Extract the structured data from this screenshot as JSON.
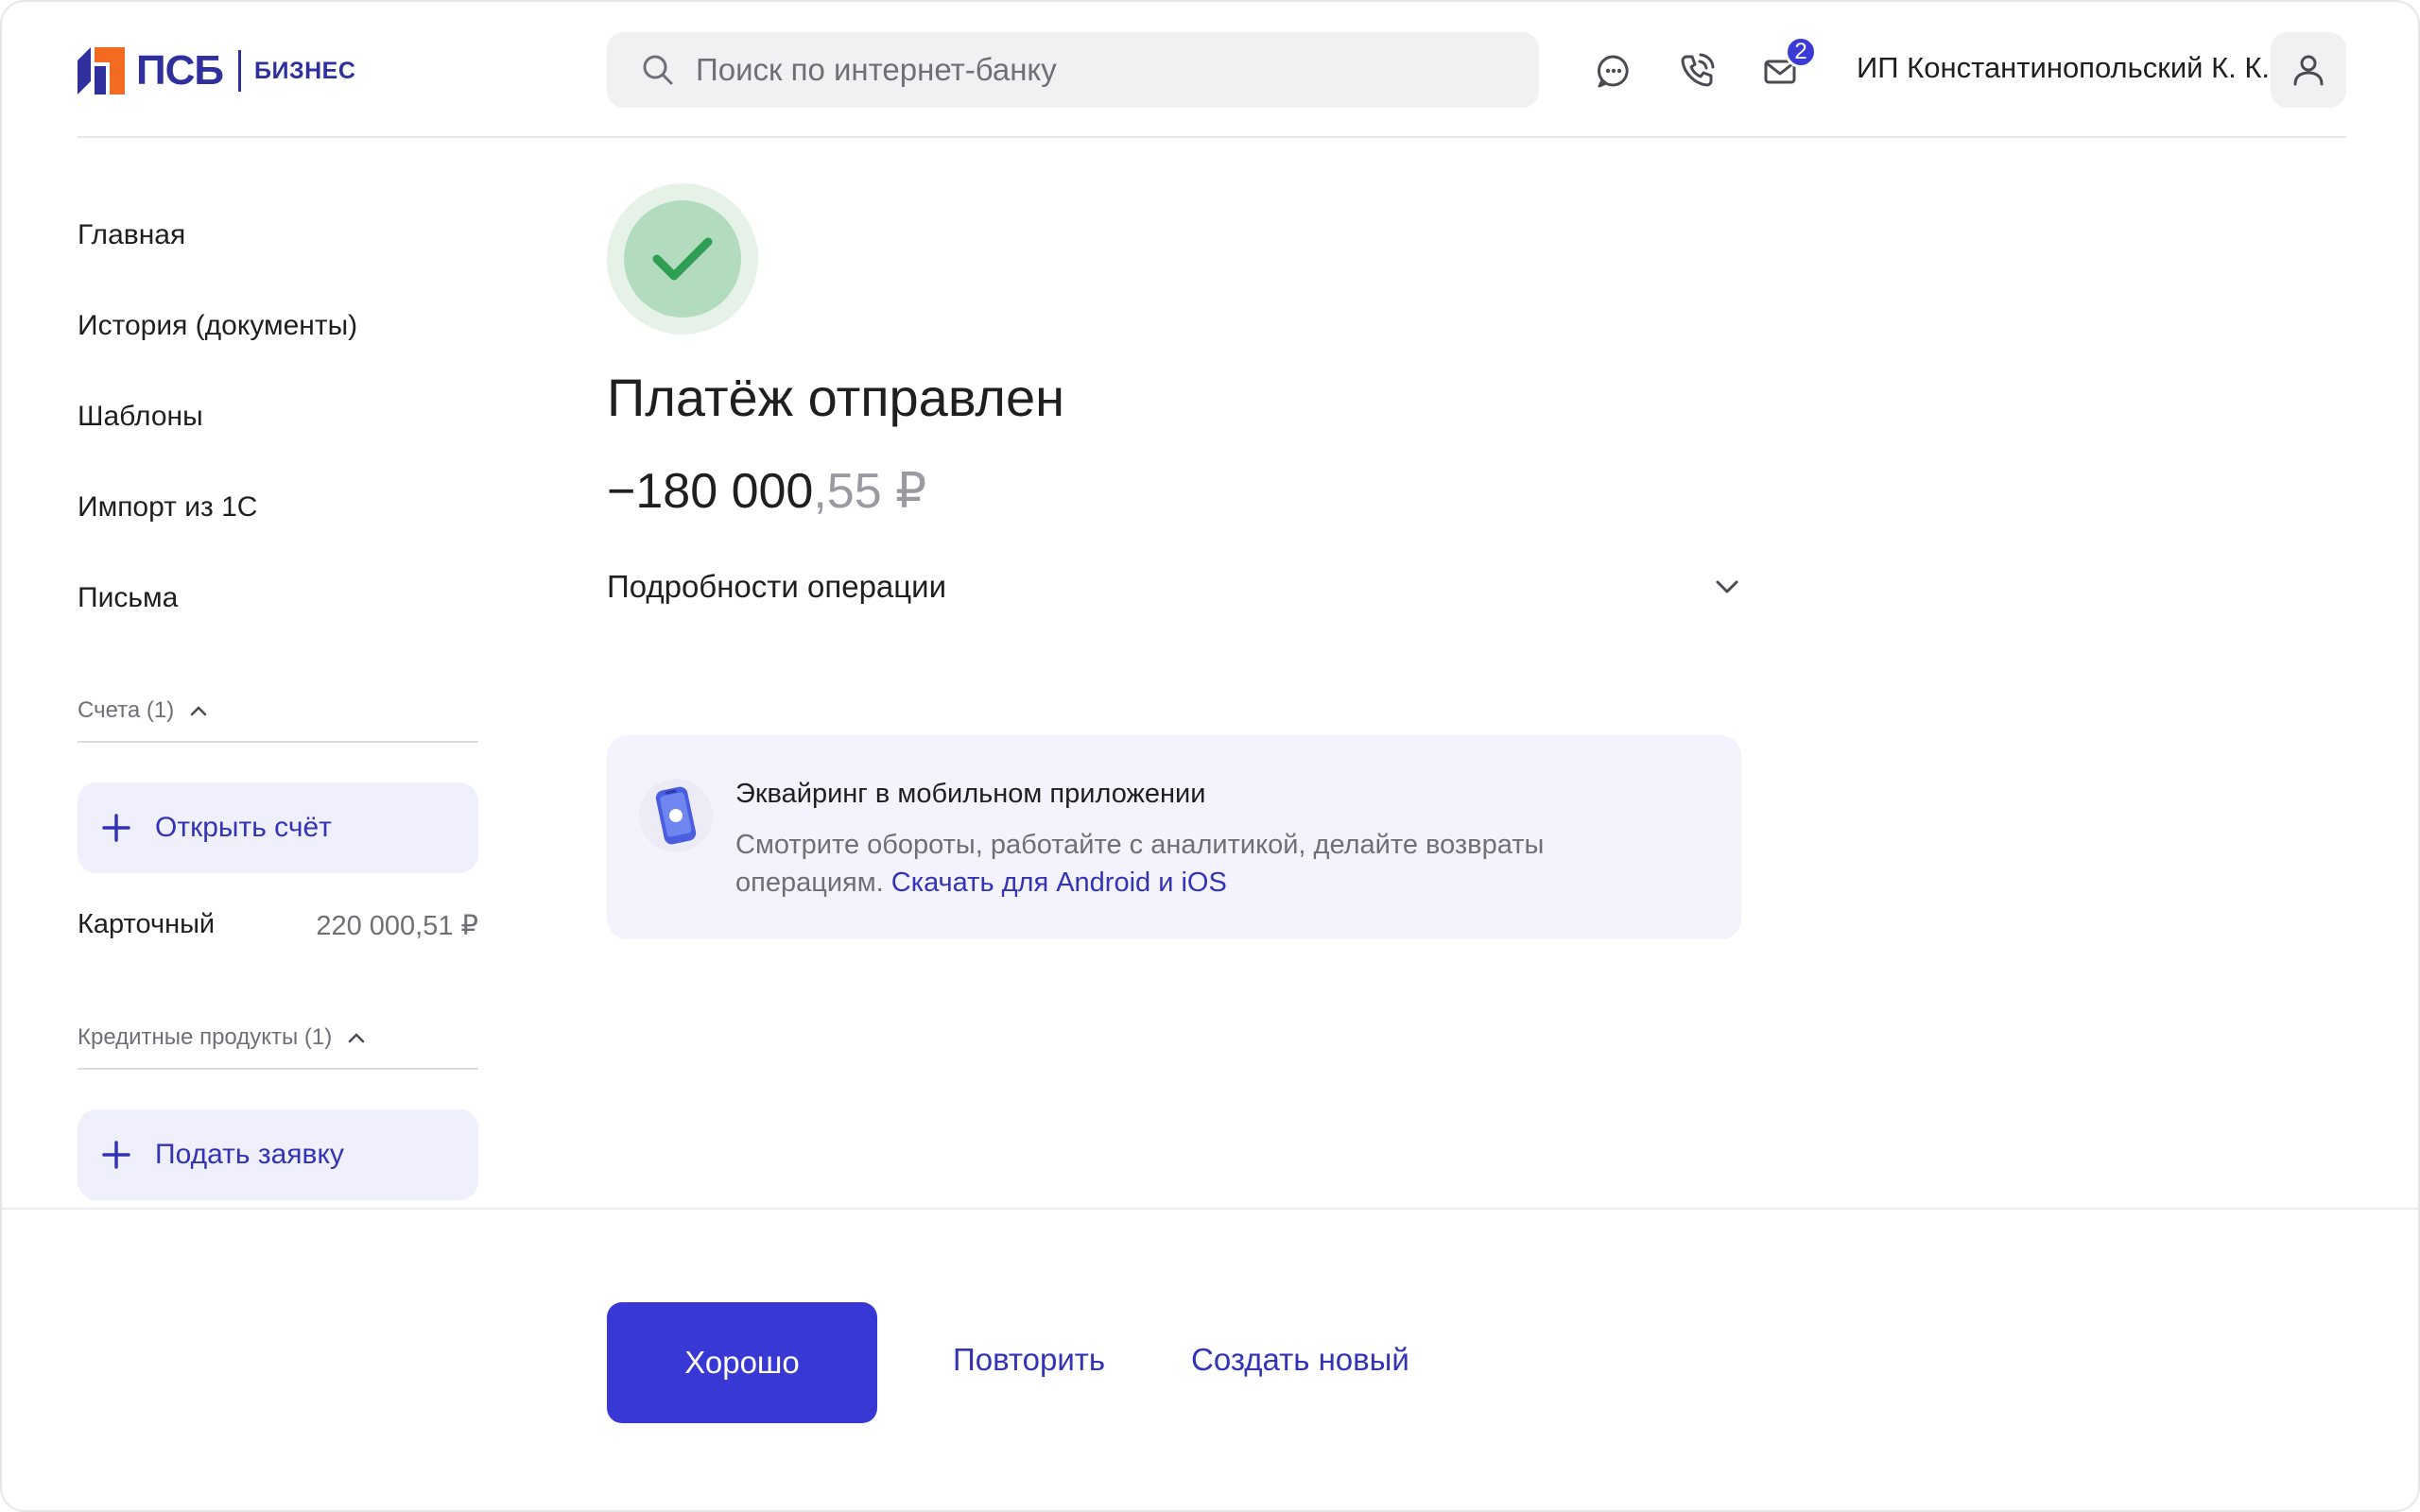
{
  "header": {
    "logo_text": "ПСБ",
    "logo_sub": "БИЗНЕС",
    "search_placeholder": "Поиск по интернет-банку",
    "icons": [
      "chat-icon",
      "phone-icon",
      "mail-icon"
    ],
    "mail_badge": "2",
    "user_name": "ИП Константинопольский К. К."
  },
  "sidebar": {
    "nav": [
      "Главная",
      "История (документы)",
      "Шаблоны",
      "Импорт из 1С",
      "Письма"
    ],
    "accounts_header": "Счета (1)",
    "open_account": "Открыть счёт",
    "account": {
      "name": "Карточный",
      "balance": "220 000,51 ₽"
    },
    "credit_header": "Кредитные продукты (1)",
    "apply": "Подать заявку"
  },
  "main": {
    "title": "Платёж отправлен",
    "amount_int": "−180 000",
    "amount_frac": ",55 ₽",
    "details_label": "Подробности операции",
    "promo": {
      "title": "Эквайринг в мобильном приложении",
      "text": "Смотрите обороты, работайте с аналитикой, делайте возвраты операциям.",
      "link": "Скачать для Android и iOS"
    }
  },
  "footer": {
    "ok": "Хорошо",
    "repeat": "Повторить",
    "create": "Создать новый"
  },
  "colors": {
    "accent": "#3838d4",
    "brand": "#2f2f9e",
    "logo_orange": "#f26b21",
    "success": "#2e9e52"
  }
}
